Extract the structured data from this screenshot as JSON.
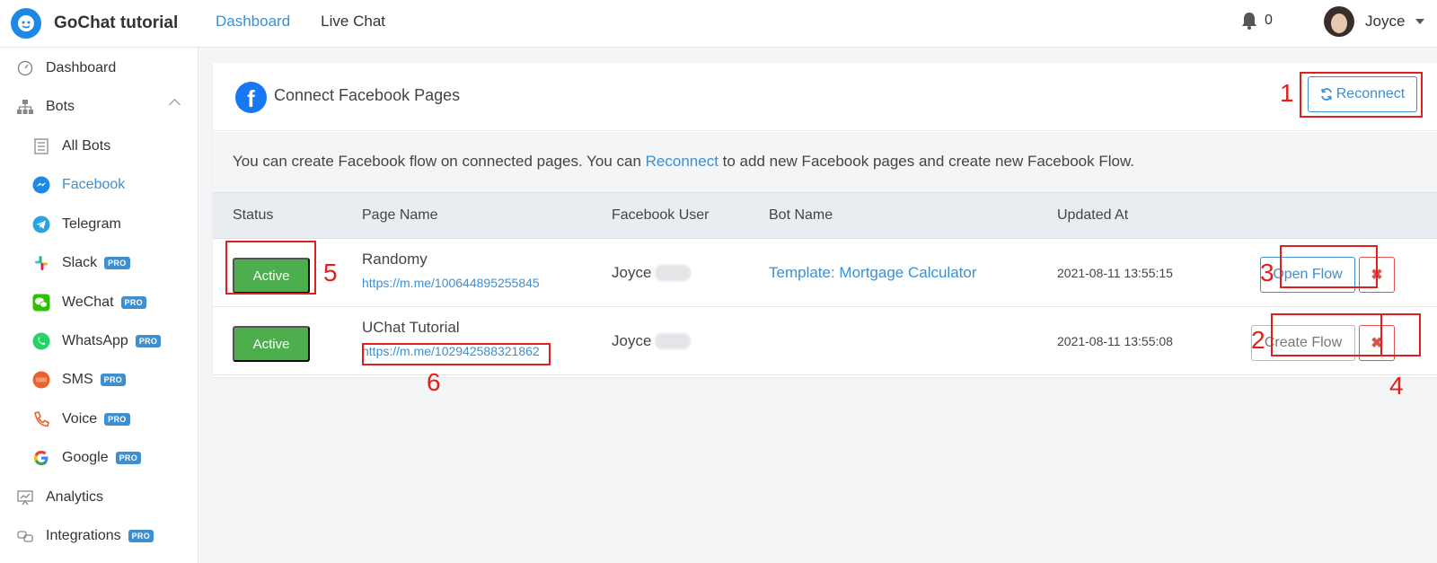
{
  "header": {
    "brand_name": "GoChat tutorial",
    "nav": [
      {
        "label": "Dashboard",
        "active": true
      },
      {
        "label": "Live Chat",
        "active": false
      }
    ],
    "notification_count": "0",
    "user_name": "Joyce"
  },
  "sidebar": {
    "items": [
      {
        "label": "Dashboard",
        "icon": "dashboard-icon"
      },
      {
        "label": "Bots",
        "icon": "sitemap-icon",
        "expanded": true
      },
      {
        "label": "All Bots",
        "icon": "list-icon"
      },
      {
        "label": "Facebook",
        "icon": "messenger-icon",
        "active": true
      },
      {
        "label": "Telegram",
        "icon": "telegram-icon"
      },
      {
        "label": "Slack",
        "icon": "slack-icon",
        "badge": "PRO"
      },
      {
        "label": "WeChat",
        "icon": "wechat-icon",
        "badge": "PRO"
      },
      {
        "label": "WhatsApp",
        "icon": "whatsapp-icon",
        "badge": "PRO"
      },
      {
        "label": "SMS",
        "icon": "sms-icon",
        "badge": "PRO"
      },
      {
        "label": "Voice",
        "icon": "phone-icon",
        "badge": "PRO"
      },
      {
        "label": "Google",
        "icon": "google-icon",
        "badge": "PRO"
      },
      {
        "label": "Analytics",
        "icon": "chart-icon"
      },
      {
        "label": "Integrations",
        "icon": "integrations-icon",
        "badge": "PRO"
      }
    ]
  },
  "card": {
    "title": "Connect Facebook Pages",
    "reconnect_label": "Reconnect",
    "info_before": "You can create Facebook flow on connected pages. You can ",
    "info_link": "Reconnect",
    "info_after": " to add new Facebook pages and create new Facebook Flow."
  },
  "table": {
    "columns": [
      "Status",
      "Page Name",
      "Facebook User",
      "Bot Name",
      "Updated At"
    ],
    "rows": [
      {
        "status": "Active",
        "page_name": "Randomy",
        "page_link": "https://m.me/100644895255845",
        "facebook_user": "Joyce",
        "bot_name": "Template: Mortgage Calculator",
        "updated_at": "2021-08-11 13:55:15",
        "action_label": "Open Flow"
      },
      {
        "status": "Active",
        "page_name": "UChat Tutorial",
        "page_link": "https://m.me/102942588321862",
        "facebook_user": "Joyce",
        "bot_name": "",
        "updated_at": "2021-08-11 13:55:08",
        "action_label": "Create Flow"
      }
    ],
    "delete_symbol": "✖"
  },
  "annotations": [
    "1",
    "2",
    "3",
    "4",
    "5",
    "6"
  ],
  "colors": {
    "accent": "#3e8fd0",
    "active_green": "#4cae4c",
    "danger": "#d9534f",
    "annotation_red": "#e0201d"
  }
}
